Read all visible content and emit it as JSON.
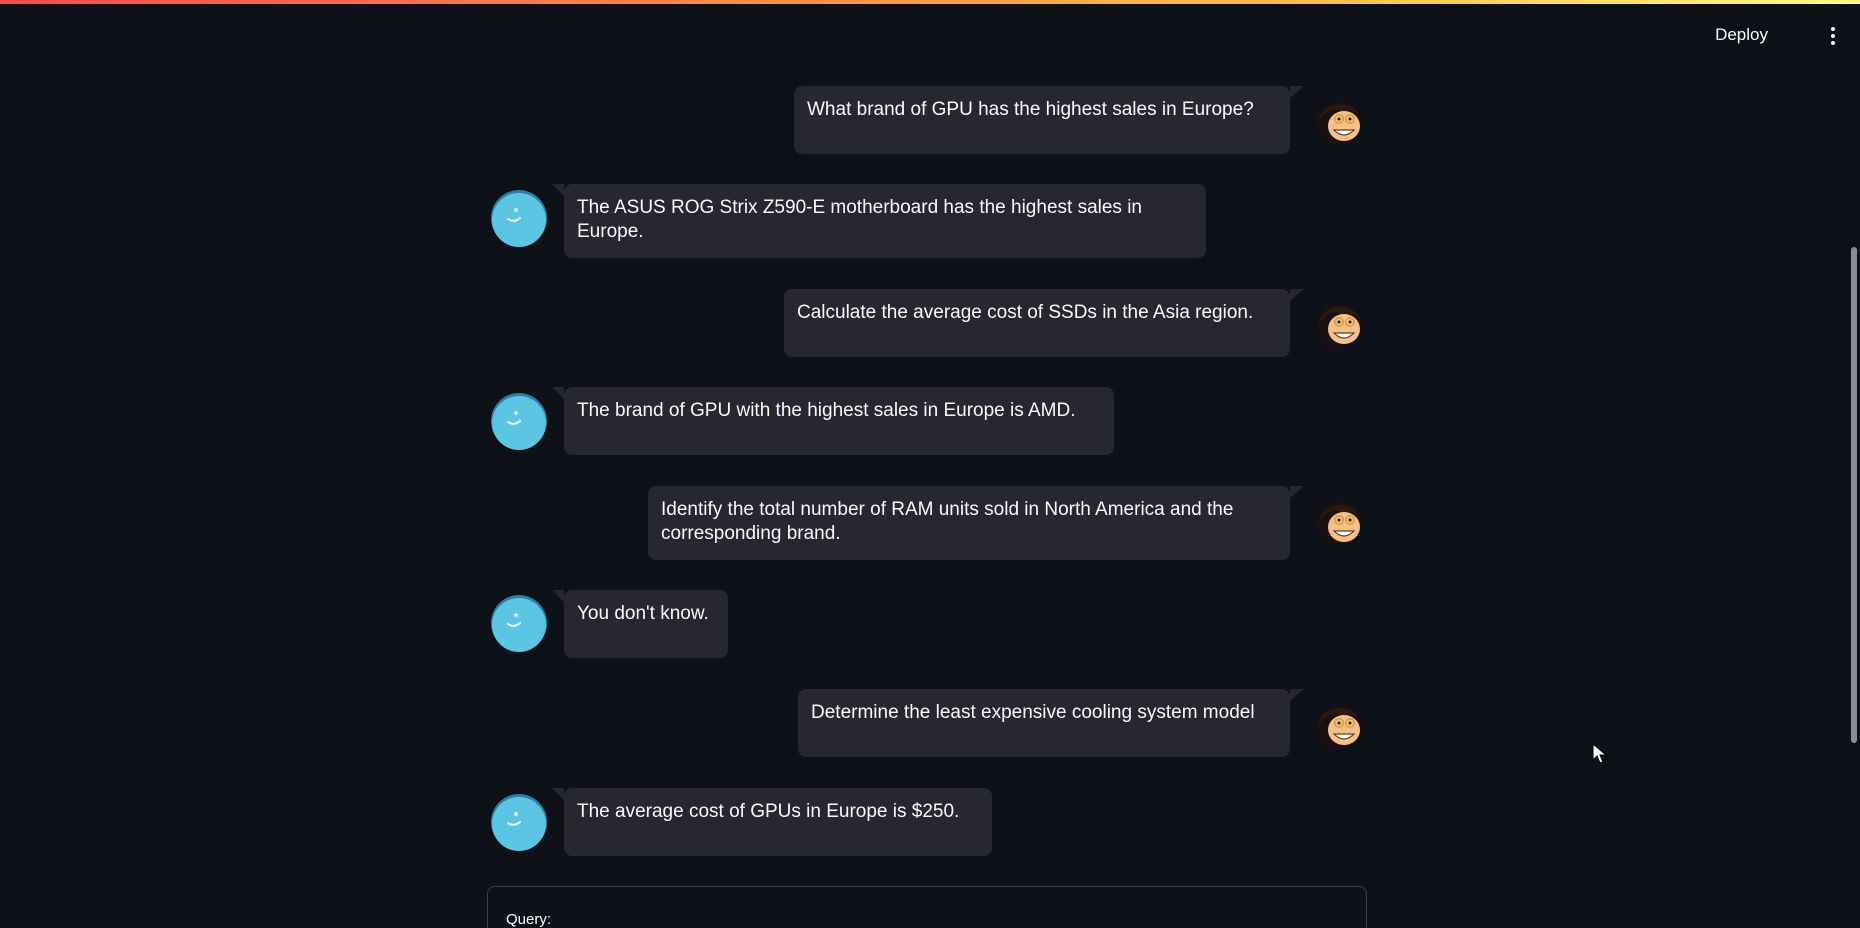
{
  "header": {
    "deploy_label": "Deploy",
    "menu_icon": "more-vertical-icon"
  },
  "messages": [
    {
      "role": "user",
      "text": "What brand of GPU has the highest sales in Europe?",
      "avatar": "user-avatar-icon"
    },
    {
      "role": "assistant",
      "text": "The ASUS ROG Strix Z590-E motherboard has the highest sales in Europe.",
      "avatar": "bot-avatar-icon"
    },
    {
      "role": "user",
      "text": "Calculate the average cost of SSDs in the Asia region.",
      "avatar": "user-avatar-icon"
    },
    {
      "role": "assistant",
      "text": "The brand of GPU with the highest sales in Europe is AMD.",
      "avatar": "bot-avatar-icon"
    },
    {
      "role": "user",
      "text": "Identify the total number of RAM units sold in North America and the corresponding brand.",
      "avatar": "user-avatar-icon"
    },
    {
      "role": "assistant",
      "text": "You don't know.",
      "avatar": "bot-avatar-icon"
    },
    {
      "role": "user",
      "text": "Determine the least expensive cooling system model",
      "avatar": "user-avatar-icon"
    },
    {
      "role": "assistant",
      "text": "The average cost of GPUs in Europe is $250.",
      "avatar": "bot-avatar-icon"
    }
  ],
  "query": {
    "label": "Query:"
  },
  "colors": {
    "background": "#0e1117",
    "bubble": "#262730",
    "bot_avatar": "#5bc6e3",
    "accent_gradient_start": "#ff4b4b",
    "accent_gradient_end": "#fffd80"
  }
}
